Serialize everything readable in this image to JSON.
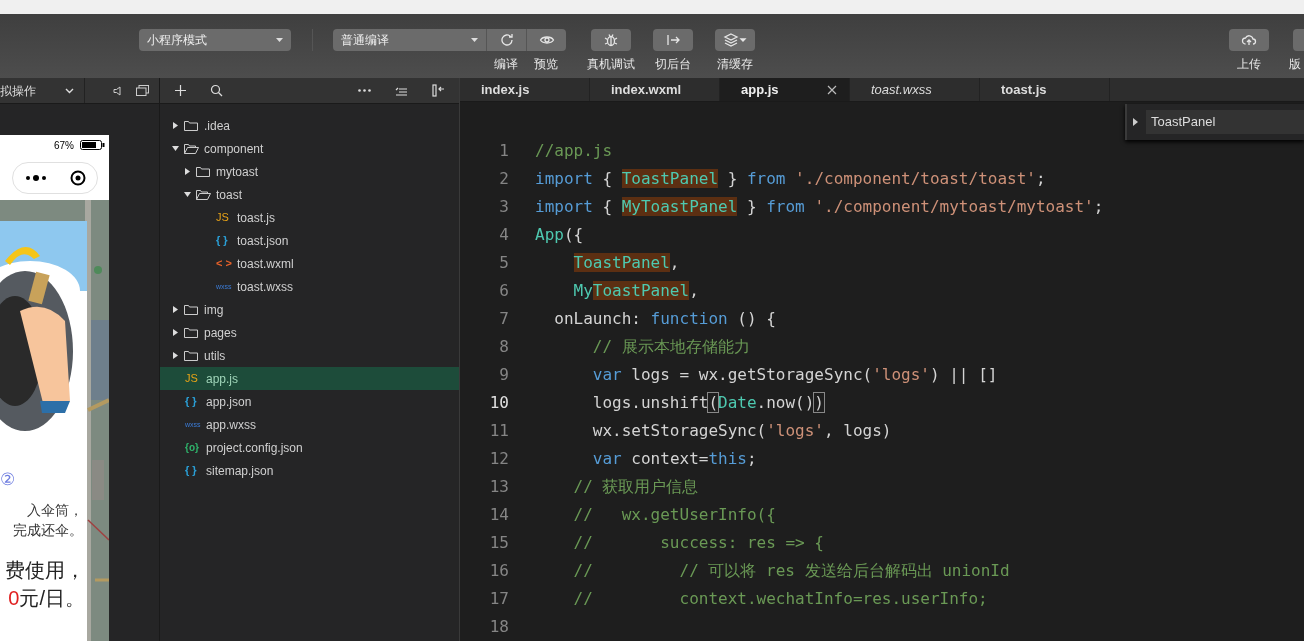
{
  "toolbar": {
    "mode_dropdown": "小程序模式",
    "compile_dropdown": "普通编译",
    "compile_tools": [
      {
        "kind": "refresh",
        "label": "编译"
      },
      {
        "kind": "eye",
        "label": "预览"
      }
    ],
    "tools": [
      {
        "kind": "bug",
        "label": "真机调试"
      },
      {
        "kind": "switch",
        "label": "切后台"
      },
      {
        "kind": "layers",
        "label": "清缓存"
      }
    ],
    "right_tools": [
      {
        "kind": "cloud",
        "label": "上传"
      },
      {
        "kind": "blank",
        "label": "版"
      }
    ]
  },
  "simulator": {
    "header": "拟操作",
    "battery_text": "67%",
    "step": "②",
    "lines": [
      "入伞筒，",
      "完成还伞。"
    ],
    "price_lines": [
      "费使用，",
      "**0**元/日。"
    ]
  },
  "explorer": {
    "items": [
      {
        "name": ".idea",
        "kind": "folder",
        "expanded": false,
        "selected": false
      },
      {
        "name": "component",
        "kind": "folder",
        "expanded": true,
        "selected": false,
        "children": [
          {
            "name": "mytoast",
            "kind": "folder",
            "expanded": false,
            "selected": false
          },
          {
            "name": "toast",
            "kind": "folder",
            "expanded": true,
            "selected": false,
            "children": [
              {
                "name": "toast.js",
                "kind": "js",
                "icon": "JS",
                "selected": false
              },
              {
                "name": "toast.json",
                "kind": "json",
                "icon": "{ }",
                "selected": false
              },
              {
                "name": "toast.wxml",
                "kind": "wxml",
                "icon": "< >",
                "selected": false
              },
              {
                "name": "toast.wxss",
                "kind": "wxss",
                "icon": "wxss",
                "selected": false
              }
            ]
          }
        ]
      },
      {
        "name": "img",
        "kind": "folder",
        "expanded": false,
        "selected": false
      },
      {
        "name": "pages",
        "kind": "folder",
        "expanded": false,
        "selected": false
      },
      {
        "name": "utils",
        "kind": "folder",
        "expanded": false,
        "selected": false
      },
      {
        "name": "app.js",
        "kind": "js",
        "icon": "JS",
        "selected": true
      },
      {
        "name": "app.json",
        "kind": "json",
        "icon": "{ }",
        "selected": false
      },
      {
        "name": "app.wxss",
        "kind": "wxss",
        "icon": "wxss",
        "selected": false
      },
      {
        "name": "project.config.json",
        "kind": "config",
        "icon": "{o}",
        "selected": false
      },
      {
        "name": "sitemap.json",
        "kind": "json",
        "icon": "{ }",
        "selected": false
      }
    ]
  },
  "tabs": [
    {
      "label": "index.js",
      "selected": false,
      "preview": false
    },
    {
      "label": "index.wxml",
      "selected": false,
      "preview": false
    },
    {
      "label": "app.js",
      "selected": true,
      "preview": false
    },
    {
      "label": "toast.wxss",
      "selected": false,
      "preview": true
    },
    {
      "label": "toast.js",
      "selected": false,
      "preview": false
    }
  ],
  "outline": {
    "item": "ToastPanel"
  },
  "code": {
    "lines": [
      {
        "number": "1",
        "current": false,
        "tokens": [
          {
            "kind": "comment",
            "text": "//app.js"
          }
        ]
      },
      {
        "number": "2",
        "current": false,
        "tokens": [
          {
            "kind": "keyword",
            "text": "import"
          },
          {
            "kind": "plain",
            "text": " { "
          },
          {
            "kind": "match",
            "text": "ToastPanel"
          },
          {
            "kind": "plain",
            "text": " } "
          },
          {
            "kind": "keyword",
            "text": "from"
          },
          {
            "kind": "string",
            "text": " './component/toast/toast'"
          },
          {
            "kind": "plain",
            "text": ";"
          }
        ]
      },
      {
        "number": "3",
        "current": false,
        "tokens": [
          {
            "kind": "keyword",
            "text": "import"
          },
          {
            "kind": "plain",
            "text": " { "
          },
          {
            "kind": "match",
            "text": "MyToastPanel"
          },
          {
            "kind": "plain",
            "text": " } "
          },
          {
            "kind": "keyword",
            "text": "from"
          },
          {
            "kind": "string",
            "text": " './component/mytoast/mytoast'"
          },
          {
            "kind": "plain",
            "text": ";"
          }
        ]
      },
      {
        "number": "4",
        "current": false,
        "tokens": [
          {
            "kind": "type",
            "text": "App"
          },
          {
            "kind": "plain",
            "text": "({"
          }
        ]
      },
      {
        "number": "5",
        "current": false,
        "tokens": [
          {
            "kind": "match",
            "text": "    ToastPanel"
          },
          {
            "kind": "plain",
            "text": ","
          }
        ]
      },
      {
        "number": "6",
        "current": false,
        "tokens": [
          {
            "kind": "type",
            "text": "    My"
          },
          {
            "kind": "match",
            "text": "ToastPanel"
          },
          {
            "kind": "plain",
            "text": ","
          }
        ]
      },
      {
        "number": "7",
        "current": false,
        "tokens": [
          {
            "kind": "plain",
            "text": "  onLaunch: "
          },
          {
            "kind": "keyword",
            "text": "function"
          },
          {
            "kind": "plain",
            "text": " () {"
          }
        ]
      },
      {
        "number": "8",
        "current": false,
        "tokens": [
          {
            "kind": "comment",
            "text": "      // 展示本地存储能力"
          }
        ]
      },
      {
        "number": "9",
        "current": false,
        "tokens": [
          {
            "kind": "keyword",
            "text": "      var"
          },
          {
            "kind": "plain",
            "text": " logs = wx.getStorageSync("
          },
          {
            "kind": "string",
            "text": "'logs'"
          },
          {
            "kind": "plain",
            "text": ") || []"
          }
        ]
      },
      {
        "number": "10",
        "current": true,
        "tokens": [
          {
            "kind": "plain",
            "text": "      logs.unshift"
          },
          {
            "kind": "bracket",
            "text": "("
          },
          {
            "kind": "type",
            "text": "Date"
          },
          {
            "kind": "plain",
            "text": ".now()"
          },
          {
            "kind": "bracket",
            "text": ")"
          }
        ]
      },
      {
        "number": "11",
        "current": false,
        "tokens": [
          {
            "kind": "plain",
            "text": "      wx.setStorageSync("
          },
          {
            "kind": "string",
            "text": "'logs'"
          },
          {
            "kind": "plain",
            "text": ", logs)"
          }
        ]
      },
      {
        "number": "12",
        "current": false,
        "tokens": [
          {
            "kind": "keyword",
            "text": "      var"
          },
          {
            "kind": "plain",
            "text": " context="
          },
          {
            "kind": "keyword",
            "text": "this"
          },
          {
            "kind": "plain",
            "text": ";"
          }
        ]
      },
      {
        "number": "13",
        "current": false,
        "tokens": [
          {
            "kind": "comment",
            "text": "    // 获取用户信息"
          }
        ]
      },
      {
        "number": "14",
        "current": false,
        "tokens": [
          {
            "kind": "comment",
            "text": "    //   wx.getUserInfo({"
          }
        ]
      },
      {
        "number": "15",
        "current": false,
        "tokens": [
          {
            "kind": "comment",
            "text": "    //       success: res => {"
          }
        ]
      },
      {
        "number": "16",
        "current": false,
        "tokens": [
          {
            "kind": "comment",
            "text": "    //         // 可以将 res 发送给后台解码出 unionId"
          }
        ]
      },
      {
        "number": "17",
        "current": false,
        "tokens": [
          {
            "kind": "comment",
            "text": "    //         context.wechatInfo=res.userInfo;"
          }
        ]
      },
      {
        "number": "18",
        "current": false
      }
    ]
  }
}
